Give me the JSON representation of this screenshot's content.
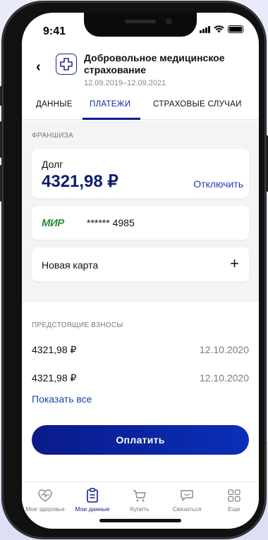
{
  "status_bar": {
    "time": "9:41"
  },
  "header": {
    "back_label": "‹",
    "title": "Добровольное медицинское страхование",
    "dates": "12.09.2019–12.09.2021"
  },
  "tabs": [
    {
      "label": "ДАННЫЕ",
      "active": false
    },
    {
      "label": "ПЛАТЕЖИ",
      "active": true
    },
    {
      "label": "СТРАХОВЫЕ СЛУЧАИ",
      "active": false
    }
  ],
  "franchise": {
    "section_label": "ФРАНШИЗА",
    "debt_label": "Долг",
    "debt_amount": "4321,98 ₽",
    "disable_label": "Отключить"
  },
  "card": {
    "system_logo": "МИР",
    "masked_number": "****** 4985"
  },
  "new_card": {
    "label": "Новая карта",
    "icon": "plus-icon"
  },
  "upcoming": {
    "section_label": "ПРЕДСТОЯЩИЕ ВЗНОСЫ",
    "rows": [
      {
        "amount": "4321,98 ₽",
        "date": "12.10.2020"
      },
      {
        "amount": "4321,98 ₽",
        "date": "12.10.2020"
      }
    ],
    "show_all_label": "Показать все",
    "pay_label": "Оплатить"
  },
  "bottom_nav": [
    {
      "label": "Мое здоровье",
      "icon": "heart-pulse-icon",
      "active": false
    },
    {
      "label": "Мои данные",
      "icon": "clipboard-icon",
      "active": true
    },
    {
      "label": "Купить",
      "icon": "cart-icon",
      "active": false
    },
    {
      "label": "Связаться",
      "icon": "chat-icon",
      "active": false
    },
    {
      "label": "Еще",
      "icon": "grid-icon",
      "active": false
    }
  ],
  "colors": {
    "accent": "#0B1F8F",
    "link": "#1E3FB0",
    "mir_green": "#2E8B3A"
  }
}
